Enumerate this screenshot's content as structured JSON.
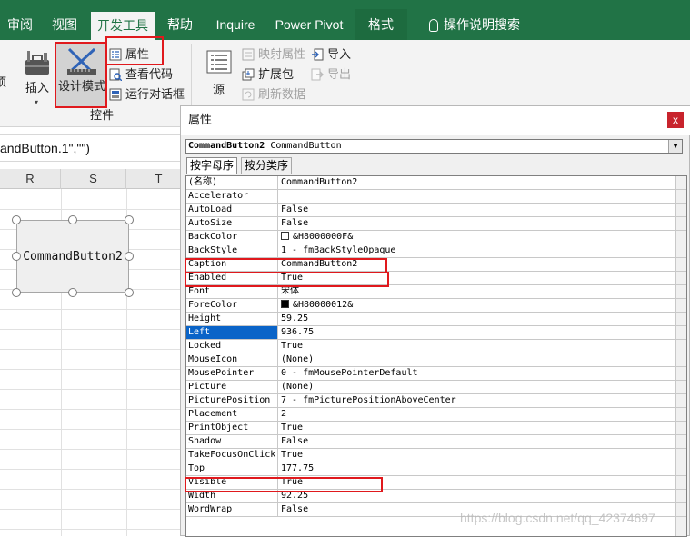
{
  "tabs": [
    "审阅",
    "视图",
    "开发工具",
    "帮助",
    "Inquire",
    "Power Pivot",
    "格式",
    "操作说明搜索"
  ],
  "ribbon": {
    "partial_left": "项",
    "insert": "插入",
    "design_mode": "设计模式",
    "properties": "属性",
    "view_code": "查看代码",
    "run_dialog": "运行对话框",
    "group_controls": "控件",
    "source": "源",
    "map_properties": "映射属性",
    "expansion_packs": "扩展包",
    "refresh_data": "刷新数据",
    "import": "导入",
    "export": "导出"
  },
  "formula_bar": "andButton.1\",\"\")",
  "columns": [
    "R",
    "S",
    "T"
  ],
  "sheet_button": "CommandButton2",
  "colors": {
    "accent": "#217346",
    "highlight": "#0a64c8",
    "annotation": "#e0191d"
  },
  "properties_window": {
    "title": "属性",
    "close": "x",
    "object": "CommandButton2",
    "object_type": "CommandButton",
    "tab_alpha": "按字母序",
    "tab_category": "按分类序",
    "rows": [
      {
        "name": "(名称)",
        "value": "CommandButton2"
      },
      {
        "name": "Accelerator",
        "value": ""
      },
      {
        "name": "AutoLoad",
        "value": "False"
      },
      {
        "name": "AutoSize",
        "value": "False"
      },
      {
        "name": "BackColor",
        "value": "&H8000000F&",
        "swatch": "#ffffff"
      },
      {
        "name": "BackStyle",
        "value": "1 - fmBackStyleOpaque"
      },
      {
        "name": "Caption",
        "value": "CommandButton2"
      },
      {
        "name": "Enabled",
        "value": "True"
      },
      {
        "name": "Font",
        "value": "宋体"
      },
      {
        "name": "ForeColor",
        "value": "&H80000012&",
        "swatch": "#000000"
      },
      {
        "name": "Height",
        "value": "59.25"
      },
      {
        "name": "Left",
        "value": "936.75"
      },
      {
        "name": "Locked",
        "value": "True"
      },
      {
        "name": "MouseIcon",
        "value": "(None)"
      },
      {
        "name": "MousePointer",
        "value": "0 - fmMousePointerDefault"
      },
      {
        "name": "Picture",
        "value": "(None)"
      },
      {
        "name": "PicturePosition",
        "value": "7 - fmPicturePositionAboveCenter"
      },
      {
        "name": "Placement",
        "value": "2"
      },
      {
        "name": "PrintObject",
        "value": "True"
      },
      {
        "name": "Shadow",
        "value": "False"
      },
      {
        "name": "TakeFocusOnClick",
        "value": "True"
      },
      {
        "name": "Top",
        "value": "177.75"
      },
      {
        "name": "Visible",
        "value": "True"
      },
      {
        "name": "Width",
        "value": "92.25"
      },
      {
        "name": "WordWrap",
        "value": "False"
      }
    ]
  },
  "watermark": "https://blog.csdn.net/qq_42374697"
}
